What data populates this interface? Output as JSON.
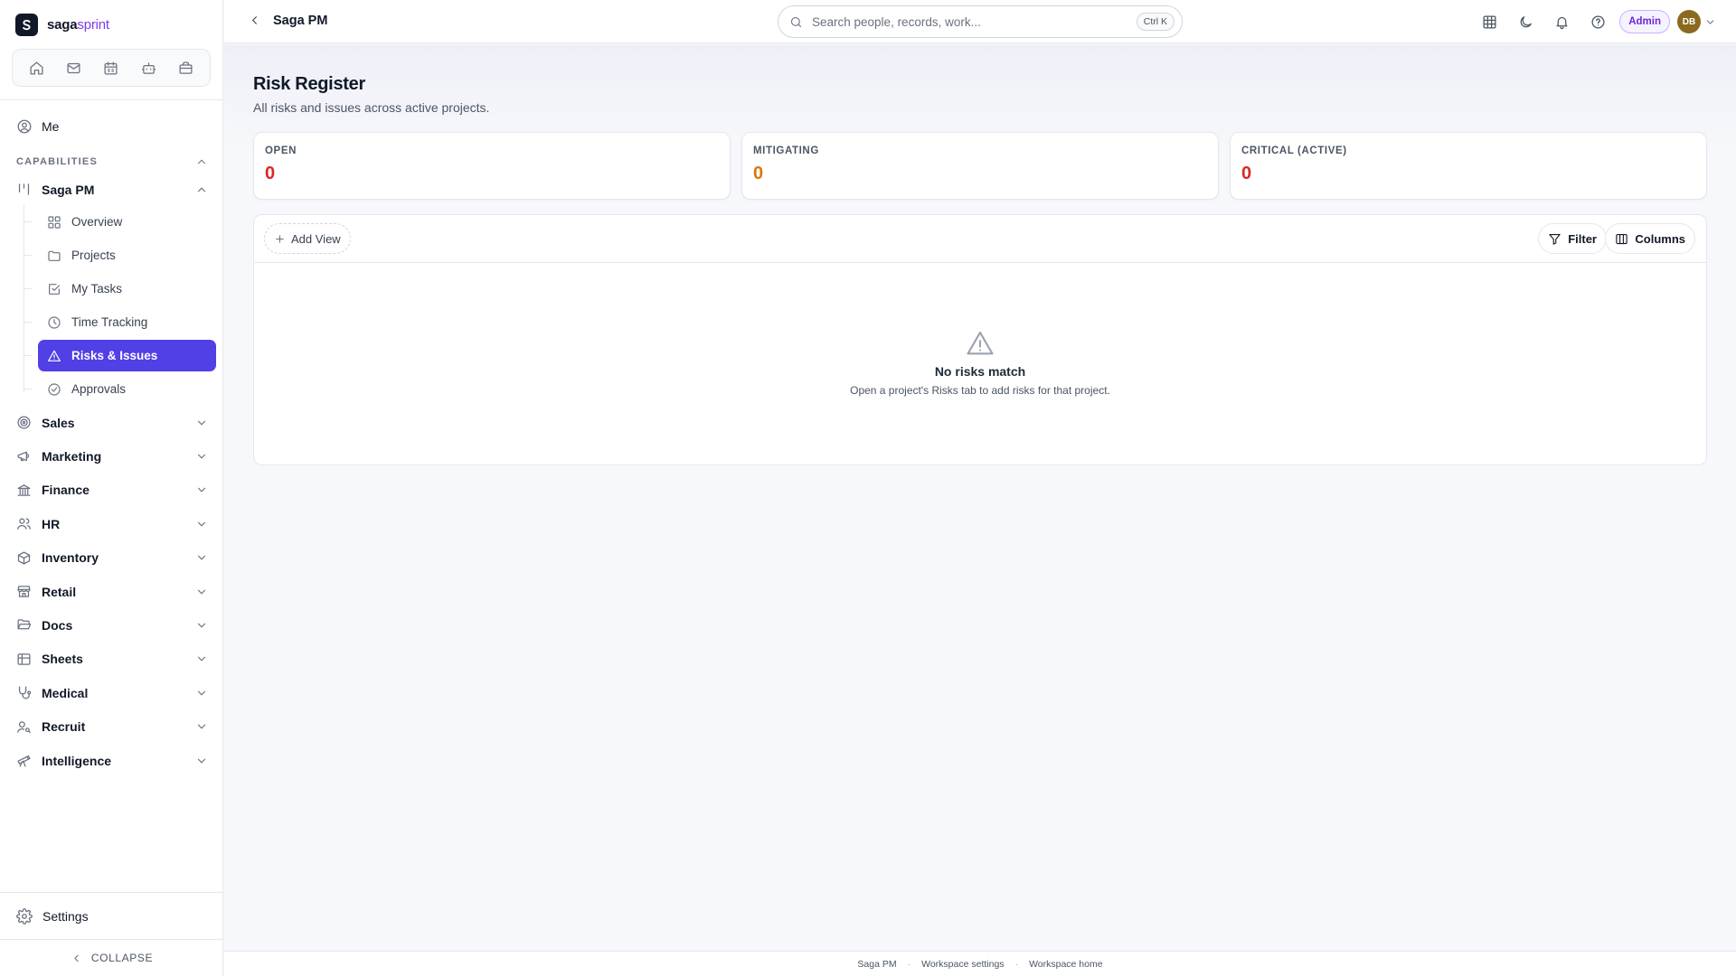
{
  "brand": {
    "name": "saga",
    "accent": "sprint",
    "logo_letter": "S"
  },
  "quickbar": [
    "home-icon",
    "mail-icon",
    "calendar-icon",
    "bot-icon",
    "briefcase-icon"
  ],
  "sidebar": {
    "me_label": "Me",
    "capabilities_label": "CAPABILITIES",
    "active_group": "Saga PM",
    "sub_items": [
      {
        "label": "Overview",
        "icon": "grid-icon"
      },
      {
        "label": "Projects",
        "icon": "folder-icon"
      },
      {
        "label": "My Tasks",
        "icon": "checkbox-icon"
      },
      {
        "label": "Time Tracking",
        "icon": "clock-icon"
      },
      {
        "label": "Risks & Issues",
        "icon": "warning-icon",
        "active": true
      },
      {
        "label": "Approvals",
        "icon": "check-circle-icon"
      }
    ],
    "groups": [
      {
        "label": "Sales",
        "icon": "target-icon"
      },
      {
        "label": "Marketing",
        "icon": "megaphone-icon"
      },
      {
        "label": "Finance",
        "icon": "bank-icon"
      },
      {
        "label": "HR",
        "icon": "users-icon"
      },
      {
        "label": "Inventory",
        "icon": "box-icon"
      },
      {
        "label": "Retail",
        "icon": "store-icon"
      },
      {
        "label": "Docs",
        "icon": "folder-open-icon"
      },
      {
        "label": "Sheets",
        "icon": "table-icon"
      },
      {
        "label": "Medical",
        "icon": "stethoscope-icon"
      },
      {
        "label": "Recruit",
        "icon": "user-search-icon"
      },
      {
        "label": "Intelligence",
        "icon": "telescope-icon"
      }
    ],
    "settings_label": "Settings",
    "collapse_label": "COLLAPSE"
  },
  "header": {
    "title": "Saga PM",
    "search_placeholder": "Search people, records, work...",
    "search_shortcut": "Ctrl K",
    "admin_label": "Admin",
    "avatar_initials": "DB"
  },
  "main": {
    "title": "Risk Register",
    "subtitle": "All risks and issues across active projects.",
    "stats": [
      {
        "label": "OPEN",
        "value": "0",
        "color": "#dc2626"
      },
      {
        "label": "MITIGATING",
        "value": "0",
        "color": "#d97706"
      },
      {
        "label": "CRITICAL (ACTIVE)",
        "value": "0",
        "color": "#dc2626"
      }
    ],
    "toolbar": {
      "add_view": "Add View",
      "filter": "Filter",
      "columns": "Columns"
    },
    "empty": {
      "title": "No risks match",
      "description": "Open a project's Risks tab to add risks for that project."
    }
  },
  "footer": {
    "links": [
      "Saga PM",
      "Workspace settings",
      "Workspace home"
    ]
  },
  "colors": {
    "accent": "#5140e6",
    "admin": "#6d28d9",
    "avatar": "#8b6a1f"
  }
}
